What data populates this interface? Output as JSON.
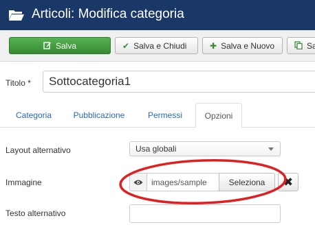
{
  "header": {
    "title": "Articoli: Modifica categoria",
    "icon": "folder-open-icon"
  },
  "toolbar": {
    "save_label": "Salva",
    "save_close_label": "Salva e Chiudi",
    "save_new_label": "Salva e Nuovo",
    "save_copy_label": "Sa"
  },
  "form": {
    "title_label": "Titolo *",
    "title_value": "Sottocategoria1"
  },
  "tabs": [
    {
      "label": "Categoria",
      "active": false
    },
    {
      "label": "Pubblicazione",
      "active": false
    },
    {
      "label": "Permessi",
      "active": false
    },
    {
      "label": "Opzioni",
      "active": true
    }
  ],
  "options": {
    "layout_label": "Layout alternativo",
    "layout_value": "Usa globali",
    "image_label": "Immagine",
    "image_path": "images/sample",
    "select_label": "Seleziona",
    "clear_label": "✖",
    "alt_label": "Testo alternativo",
    "alt_value": ""
  },
  "colors": {
    "header_bg": "#1a3867",
    "save_green": "#46a546",
    "annotation_red": "#e02020",
    "link_blue": "#2a69b8"
  }
}
